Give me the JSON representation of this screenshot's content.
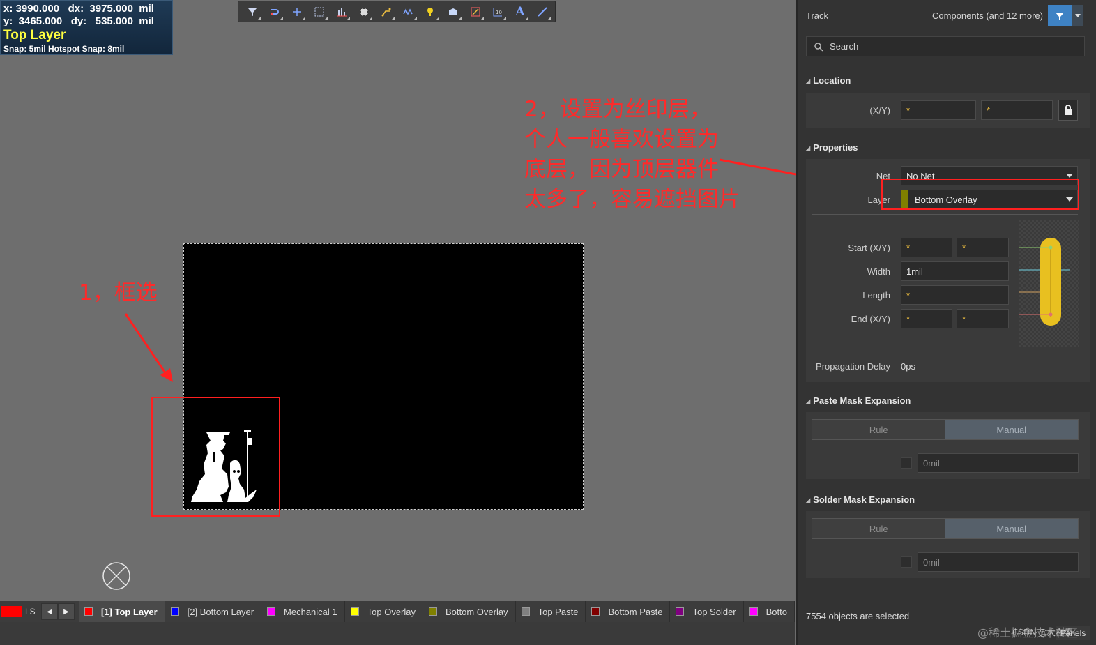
{
  "hud": {
    "x_line": "x: 3990.000   dx:  3975.000  mil",
    "y_line": "y:  3465.000   dy:   535.000  mil",
    "layer": "Top Layer",
    "snap": "Snap: 5mil Hotspot Snap: 8mil"
  },
  "toolbar": {
    "icons": [
      "filter-icon",
      "route-icon",
      "cross-icon",
      "select-rect-icon",
      "bar-chart-icon",
      "chip-icon",
      "interactive-route-icon",
      "diff-pair-icon",
      "pad-icon",
      "polygon-icon",
      "keepout-icon",
      "dimension-icon",
      "text-icon",
      "line-icon"
    ]
  },
  "annotations": {
    "step1": "1，框选",
    "step2_lines": [
      "2，设置为丝印层，",
      "个人一般喜欢设置为",
      "底层，因为顶层器件",
      "太多了，容易遮挡图片"
    ]
  },
  "layer_bar": {
    "ls_label": "LS",
    "tabs": [
      {
        "label": "[1] Top Layer",
        "color": "#ff0000",
        "active": true
      },
      {
        "label": "[2] Bottom Layer",
        "color": "#0000ff",
        "active": false
      },
      {
        "label": "Mechanical 1",
        "color": "#ff00ff",
        "active": false
      },
      {
        "label": "Top Overlay",
        "color": "#ffff00",
        "active": false
      },
      {
        "label": "Bottom Overlay",
        "color": "#808000",
        "active": false
      },
      {
        "label": "Top Paste",
        "color": "#808080",
        "active": false
      },
      {
        "label": "Bottom Paste",
        "color": "#800000",
        "active": false
      },
      {
        "label": "Top Solder",
        "color": "#800080",
        "active": false
      },
      {
        "label": "Botto",
        "color": "#ff00ff",
        "active": false
      }
    ]
  },
  "panel": {
    "object_type": "Track",
    "filter_text": "Components (and 12 more)",
    "search_placeholder": "Search",
    "location": {
      "title": "Location",
      "xy_label": "(X/Y)",
      "x": "*",
      "y": "*"
    },
    "properties": {
      "title": "Properties",
      "net_label": "Net",
      "net_value": "No Net",
      "layer_label": "Layer",
      "layer_value": "Bottom Overlay",
      "layer_color": "#808000",
      "start_label": "Start (X/Y)",
      "start_x": "*",
      "start_y": "*",
      "width_label": "Width",
      "width_value": "1mil",
      "length_label": "Length",
      "length_value": "*",
      "end_label": "End (X/Y)",
      "end_x": "*",
      "end_y": "*",
      "prop_delay_label": "Propagation Delay",
      "prop_delay_value": "0ps"
    },
    "paste_mask": {
      "title": "Paste Mask Expansion",
      "rule": "Rule",
      "manual": "Manual",
      "value": "0mil"
    },
    "solder_mask": {
      "title": "Solder Mask Expansion",
      "rule": "Rule",
      "manual": "Manual",
      "value": "0mil"
    },
    "status": "7554 objects are selected",
    "panels_button": "Panels"
  },
  "watermark": "@稀土掘金技术社区",
  "csdn_mark": "CSDN @大白菜"
}
